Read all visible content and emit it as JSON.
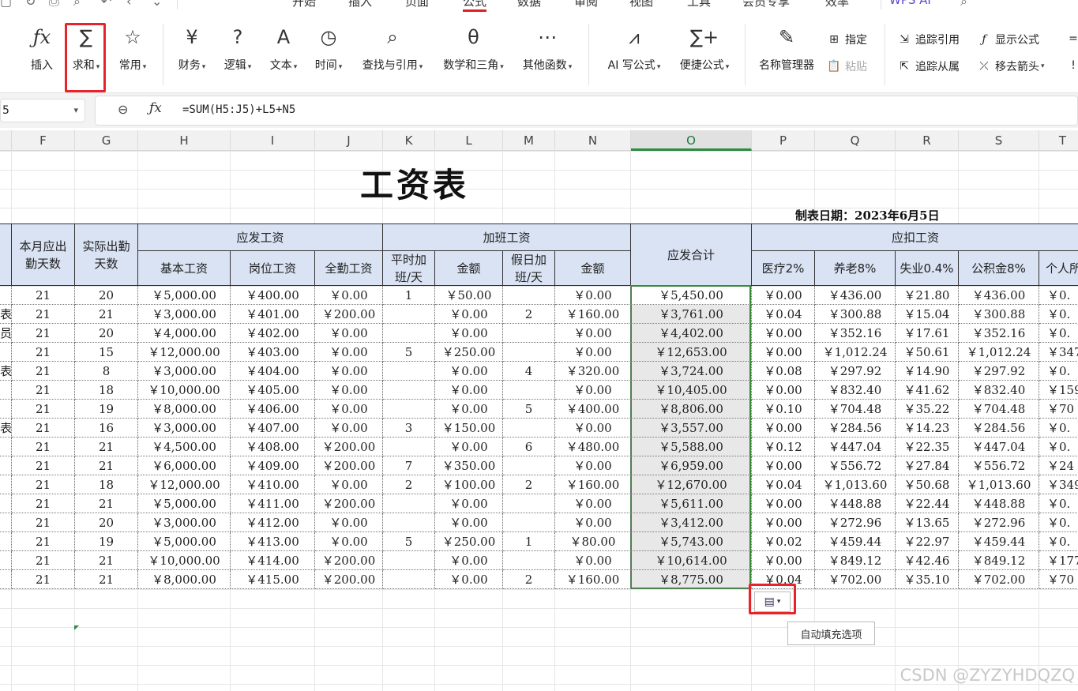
{
  "menu": {
    "tabs": [
      "开始",
      "插入",
      "页面",
      "公式",
      "数据",
      "审阅",
      "视图",
      "工具",
      "会员专享",
      "效率"
    ],
    "active_tab": "公式",
    "wps_ai": "WPS AI"
  },
  "ribbon": {
    "insert_fn": "插入",
    "autosum": "求和",
    "common": "常用",
    "finance": "财务",
    "logic": "逻辑",
    "text": "文本",
    "time": "时间",
    "lookup": "查找与引用",
    "math": "数学和三角",
    "other": "其他函数",
    "ai_formula": "AI 写公式",
    "quick_formula": "便捷公式",
    "name_manager": "名称管理器",
    "assign": "指定",
    "paste": "粘贴",
    "trace_precedents": "追踪引用",
    "trace_dependents": "追踪从属",
    "show_formulas": "显示公式",
    "remove_arrows": "移去箭头"
  },
  "formula_bar": {
    "name_box": "5",
    "formula": "=SUM(H5:J5)+L5+N5"
  },
  "columns": [
    "F",
    "G",
    "H",
    "I",
    "J",
    "K",
    "L",
    "M",
    "N",
    "O",
    "P",
    "Q",
    "R",
    "S",
    "T"
  ],
  "selected_column": "O",
  "sheet": {
    "title": "工资表",
    "date": "制表日期：2023年6月5日",
    "headers": {
      "days_due": "本月应出勤天数",
      "days_actual": "实际出勤天数",
      "pay_group": "应发工资",
      "base": "基本工资",
      "post": "岗位工资",
      "attendance": "全勤工资",
      "ot_group": "加班工资",
      "weekday_ot": "平时加班/天",
      "amount1": "金额",
      "holiday_ot": "假日加班/天",
      "amount2": "金额",
      "total": "应发合计",
      "deduct_group": "应扣工资",
      "medical": "医疗2%",
      "pension": "养老8%",
      "unemployment": "失业0.4%",
      "fund": "公积金8%",
      "personal": "个人所"
    },
    "left_cut_chars": [
      "",
      "表",
      "员",
      "",
      "表",
      "",
      "",
      "表",
      "",
      "",
      "",
      "",
      "",
      "",
      "",
      ""
    ],
    "rows": [
      [
        "21",
        "20",
        "￥5,000.00",
        "￥400.00",
        "￥0.00",
        "1",
        "￥50.00",
        "",
        "￥0.00",
        "￥5,450.00",
        "￥0.00",
        "￥436.00",
        "￥21.80",
        "￥436.00",
        "￥0."
      ],
      [
        "21",
        "21",
        "￥3,000.00",
        "￥401.00",
        "￥200.00",
        "",
        "￥0.00",
        "2",
        "￥160.00",
        "￥3,761.00",
        "￥0.04",
        "￥300.88",
        "￥15.04",
        "￥300.88",
        "￥0."
      ],
      [
        "21",
        "20",
        "￥4,000.00",
        "￥402.00",
        "￥0.00",
        "",
        "￥0.00",
        "",
        "￥0.00",
        "￥4,402.00",
        "￥0.00",
        "￥352.16",
        "￥17.61",
        "￥352.16",
        "￥0."
      ],
      [
        "21",
        "15",
        "￥12,000.00",
        "￥403.00",
        "￥0.00",
        "5",
        "￥250.00",
        "",
        "￥0.00",
        "￥12,653.00",
        "￥0.00",
        "￥1,012.24",
        "￥50.61",
        "￥1,012.24",
        "￥347"
      ],
      [
        "21",
        "8",
        "￥3,000.00",
        "￥404.00",
        "￥0.00",
        "",
        "￥0.00",
        "4",
        "￥320.00",
        "￥3,724.00",
        "￥0.08",
        "￥297.92",
        "￥14.90",
        "￥297.92",
        "￥0."
      ],
      [
        "21",
        "18",
        "￥10,000.00",
        "￥405.00",
        "￥0.00",
        "",
        "￥0.00",
        "",
        "￥0.00",
        "￥10,405.00",
        "￥0.00",
        "￥832.40",
        "￥41.62",
        "￥832.40",
        "￥159"
      ],
      [
        "21",
        "19",
        "￥8,000.00",
        "￥406.00",
        "￥0.00",
        "",
        "￥0.00",
        "5",
        "￥400.00",
        "￥8,806.00",
        "￥0.10",
        "￥704.48",
        "￥35.22",
        "￥704.48",
        "￥70"
      ],
      [
        "21",
        "16",
        "￥3,000.00",
        "￥407.00",
        "￥0.00",
        "3",
        "￥150.00",
        "",
        "￥0.00",
        "￥3,557.00",
        "￥0.00",
        "￥284.56",
        "￥14.23",
        "￥284.56",
        "￥0."
      ],
      [
        "21",
        "21",
        "￥4,500.00",
        "￥408.00",
        "￥200.00",
        "",
        "￥0.00",
        "6",
        "￥480.00",
        "￥5,588.00",
        "￥0.12",
        "￥447.04",
        "￥22.35",
        "￥447.04",
        "￥0."
      ],
      [
        "21",
        "21",
        "￥6,000.00",
        "￥409.00",
        "￥200.00",
        "7",
        "￥350.00",
        "",
        "￥0.00",
        "￥6,959.00",
        "￥0.00",
        "￥556.72",
        "￥27.84",
        "￥556.72",
        "￥24"
      ],
      [
        "21",
        "18",
        "￥12,000.00",
        "￥410.00",
        "￥0.00",
        "2",
        "￥100.00",
        "2",
        "￥160.00",
        "￥12,670.00",
        "￥0.04",
        "￥1,013.60",
        "￥50.68",
        "￥1,013.60",
        "￥349"
      ],
      [
        "21",
        "21",
        "￥5,000.00",
        "￥411.00",
        "￥200.00",
        "",
        "￥0.00",
        "",
        "￥0.00",
        "￥5,611.00",
        "￥0.00",
        "￥448.88",
        "￥22.44",
        "￥448.88",
        "￥0."
      ],
      [
        "21",
        "20",
        "￥3,000.00",
        "￥412.00",
        "￥0.00",
        "",
        "￥0.00",
        "",
        "￥0.00",
        "￥3,412.00",
        "￥0.00",
        "￥272.96",
        "￥13.65",
        "￥272.96",
        "￥0."
      ],
      [
        "21",
        "19",
        "￥5,000.00",
        "￥413.00",
        "￥0.00",
        "5",
        "￥250.00",
        "1",
        "￥80.00",
        "￥5,743.00",
        "￥0.02",
        "￥459.44",
        "￥22.97",
        "￥459.44",
        "￥0."
      ],
      [
        "21",
        "21",
        "￥10,000.00",
        "￥414.00",
        "￥200.00",
        "",
        "￥0.00",
        "",
        "￥0.00",
        "￥10,614.00",
        "￥0.00",
        "￥849.12",
        "￥42.46",
        "￥849.12",
        "￥177"
      ],
      [
        "21",
        "21",
        "￥8,000.00",
        "￥415.00",
        "￥200.00",
        "",
        "￥0.00",
        "2",
        "￥160.00",
        "￥8,775.00",
        "￥0.04",
        "￥702.00",
        "￥35.10",
        "￥702.00",
        "￥70"
      ]
    ]
  },
  "autofill_tooltip": "自动填充选项",
  "watermark": "CSDN @ZYZYHDQZQ",
  "colors": {
    "highlight_red": "#e8242a",
    "header_fill": "#dae3f3",
    "selection_green": "#3a8a3a"
  }
}
